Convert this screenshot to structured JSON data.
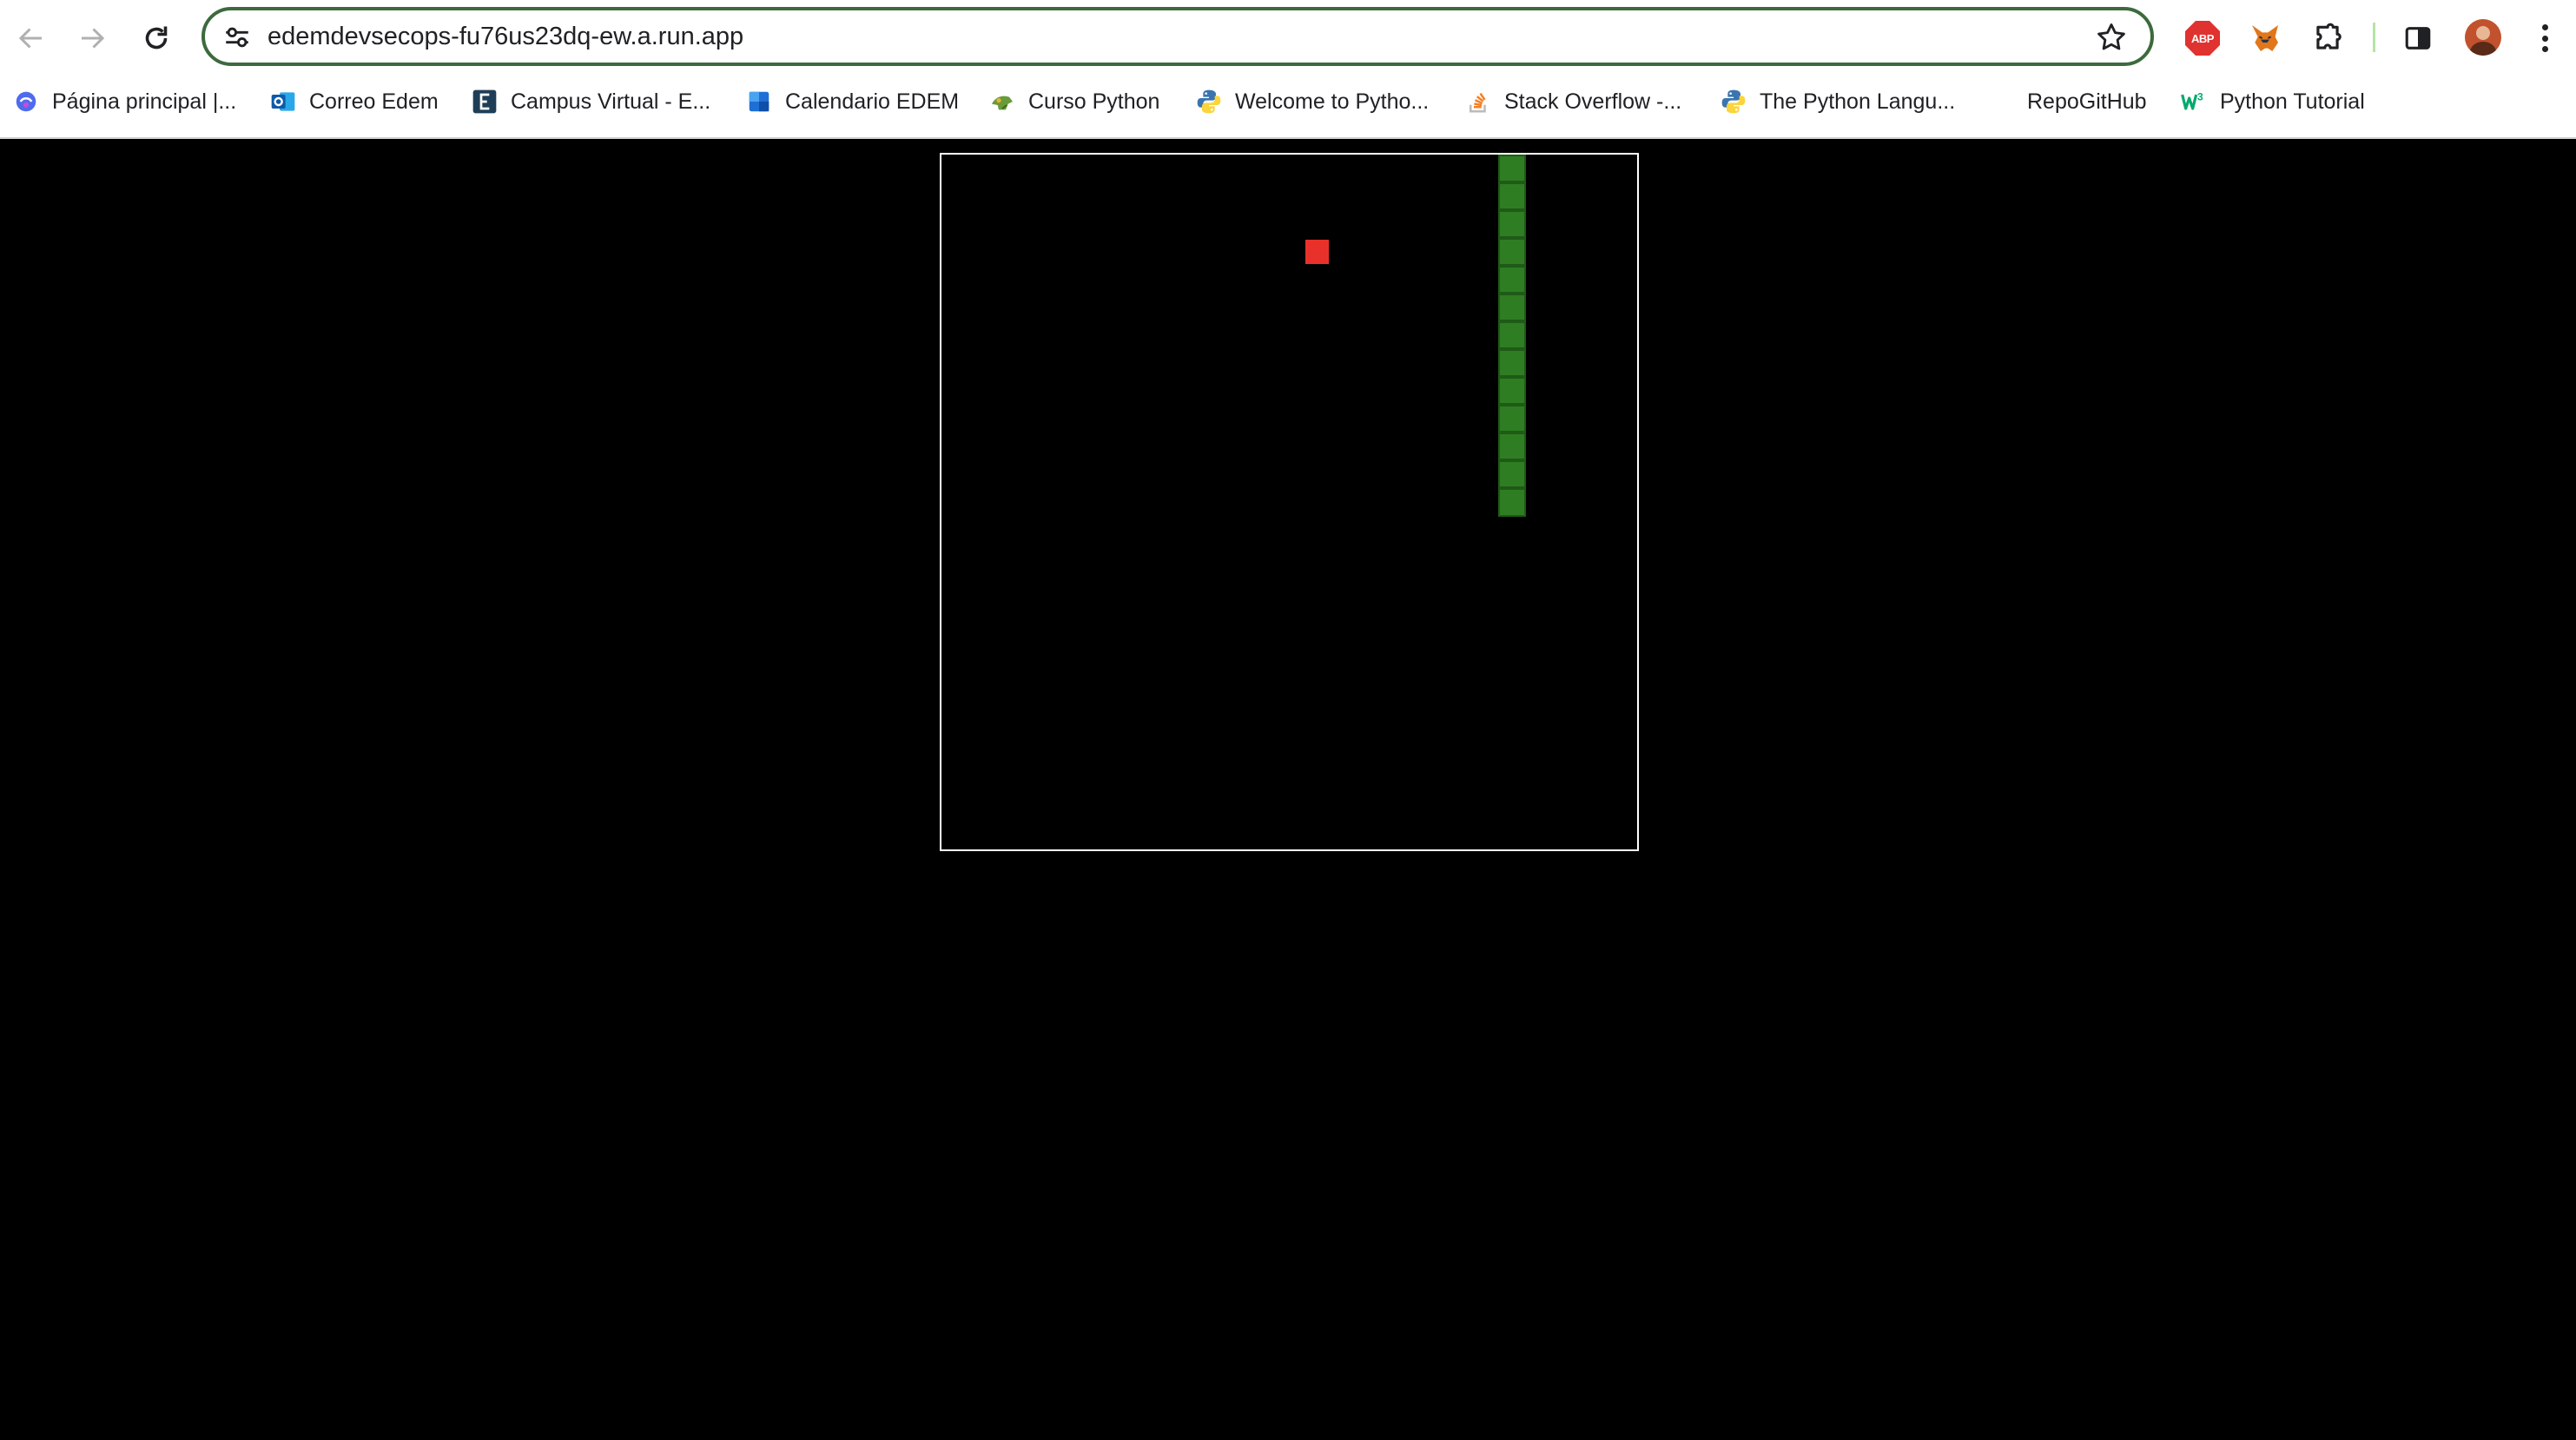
{
  "browser": {
    "url": "edemdevsecops-fu76us23dq-ew.a.run.app",
    "extensions": [
      "adblock-plus-icon",
      "metamask-fox-icon",
      "puzzle-extensions-icon",
      "side-panel-icon"
    ],
    "abp_label": "ABP"
  },
  "bookmarks": [
    {
      "label": "Página principal |...",
      "icon": "copilot-icon"
    },
    {
      "label": "Correo Edem",
      "icon": "outlook-icon"
    },
    {
      "label": "Campus Virtual - E...",
      "icon": "campus-e-icon"
    },
    {
      "label": "Calendario EDEM",
      "icon": "calendar-icon"
    },
    {
      "label": "Curso Python",
      "icon": "course-icon"
    },
    {
      "label": "Welcome to Pytho...",
      "icon": "python-icon"
    },
    {
      "label": "Stack Overflow -...",
      "icon": "stackoverflow-icon"
    },
    {
      "label": "The Python Langu...",
      "icon": "python-icon"
    },
    {
      "label": "RepoGitHub",
      "icon": ""
    },
    {
      "label": "Python Tutorial",
      "icon": "w3schools-icon"
    }
  ],
  "game": {
    "grid_cells": 25,
    "snake": [
      [
        20,
        0
      ],
      [
        20,
        1
      ],
      [
        20,
        2
      ],
      [
        20,
        3
      ],
      [
        20,
        4
      ],
      [
        20,
        5
      ],
      [
        20,
        6
      ],
      [
        20,
        7
      ],
      [
        20,
        8
      ],
      [
        20,
        9
      ],
      [
        20,
        10
      ],
      [
        20,
        11
      ],
      [
        20,
        12
      ]
    ],
    "food": [
      13,
      3
    ],
    "colors": {
      "background": "#000000",
      "border": "#ffffff",
      "snake": "#2e7d22",
      "food": "#e8312a"
    }
  }
}
